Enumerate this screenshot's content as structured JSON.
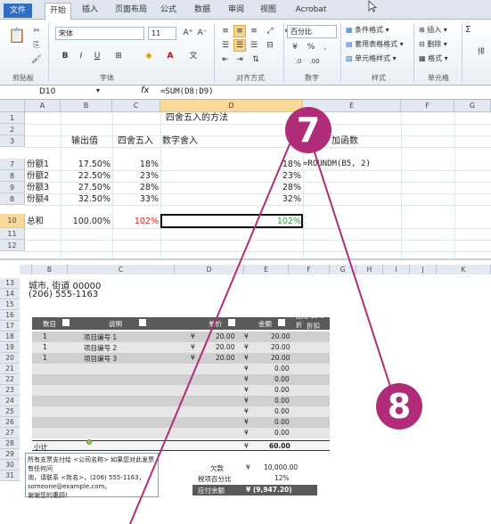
{
  "ribbon_tabs": [
    "文件",
    "开始",
    "插入",
    "页面布局",
    "公式",
    "数据",
    "审阅",
    "视图",
    "Acrobat"
  ],
  "ribbon": {
    "font_name": "宋体",
    "font_size": "11",
    "font_grow": "A⁺",
    "font_shrink": "A⁻",
    "bold": "B",
    "italic": "I",
    "underline": "U",
    "wen": "文",
    "number_format": "百分比",
    "cond_format": "条件格式",
    "table_format": "套用表格格式",
    "cell_style": "单元格样式",
    "insert": "插入",
    "delete": "删除",
    "format": "格式",
    "sum": "Σ",
    "sort": "排",
    "group_clipboard": "剪贴板",
    "group_font": "字体",
    "group_align": "对齐方式",
    "group_number": "数字",
    "group_styles": "样式",
    "group_cells": "单元格"
  },
  "formula_bar": {
    "name_box": "D10",
    "fx": "fx",
    "formula": "=SUM(D8:D9)"
  },
  "sheet1": {
    "columns": [
      "A",
      "B",
      "C",
      "D",
      "E",
      "F",
      "G"
    ],
    "rows": [
      "1",
      "2",
      "3",
      "7",
      "8",
      "9",
      "8",
      "10",
      "11",
      "12"
    ],
    "title": "四舍五入的方法",
    "header_b": "输出值",
    "header_c": "四舍五入",
    "header_d": "数字舍入",
    "header_e": "加函数",
    "data": [
      {
        "a": "份额1",
        "b": "17.50%",
        "c": "18%",
        "e": "18%",
        "f": "=ROUNDM(B5, 2)"
      },
      {
        "a": "份额2",
        "b": "22.50%",
        "c": "23%",
        "e": "23%",
        "f": ""
      },
      {
        "a": "份额3",
        "b": "27.50%",
        "c": "28%",
        "e": "28%",
        "f": ""
      },
      {
        "a": "份额4",
        "b": "32.50%",
        "c": "33%",
        "e": "32%",
        "f": ""
      }
    ],
    "total": {
      "a": "总和",
      "b": "100.00%",
      "c": "102%",
      "e": "102%"
    }
  },
  "sheet2": {
    "columns": [
      "B",
      "C",
      "D",
      "E",
      "F",
      "G",
      "H",
      "I",
      "J",
      "K"
    ],
    "rows": [
      "13",
      "14",
      "15",
      "16",
      "17",
      "18",
      "19",
      "20",
      "21",
      "22",
      "23",
      "24",
      "25",
      "26",
      "27",
      "28",
      "29",
      "30",
      "31"
    ],
    "address_line1": "城市, 街道 00000",
    "address_line2": "(206) 555-1163",
    "table_headers": {
      "qty": "数目",
      "desc": "说明",
      "price": "单价",
      "amount": "金额",
      "discount": "折扣"
    },
    "discount_note": "应用 10% 折",
    "items": [
      {
        "qty": "1",
        "desc": "项目编号 1",
        "cur1": "¥",
        "price": "20.00",
        "cur2": "¥",
        "amount": "20.00"
      },
      {
        "qty": "1",
        "desc": "项目编号 2",
        "cur1": "¥",
        "price": "20.00",
        "cur2": "¥",
        "amount": "20.00"
      },
      {
        "qty": "1",
        "desc": "项目编号 3",
        "cur1": "¥",
        "price": "20.00",
        "cur2": "¥",
        "amount": "20.00"
      }
    ],
    "empty_amount": "0.00",
    "subtotal_label": "小计",
    "subtotal_value": "60.00",
    "note_lines": [
      "所有支票支付给 <公司名称> 如果您对此发票有任何问",
      "询，请联系 <姓名>，(206) 555-1163，",
      "someone@example.com。",
      "谢谢您的惠顾！"
    ],
    "owed_label": "欠款",
    "owed_cur": "¥",
    "owed_value": "10,000.00",
    "tax_label": "税项百分比",
    "tax_value": "12%",
    "balance_label": "应付余额",
    "balance_value": "¥ (9,947.20)"
  },
  "callouts": [
    "7",
    "8"
  ],
  "colors": {
    "accent": "#b02c79",
    "file_tab": "#2f6fbf",
    "red_value": "#e02020",
    "green_value": "#3aa040"
  }
}
